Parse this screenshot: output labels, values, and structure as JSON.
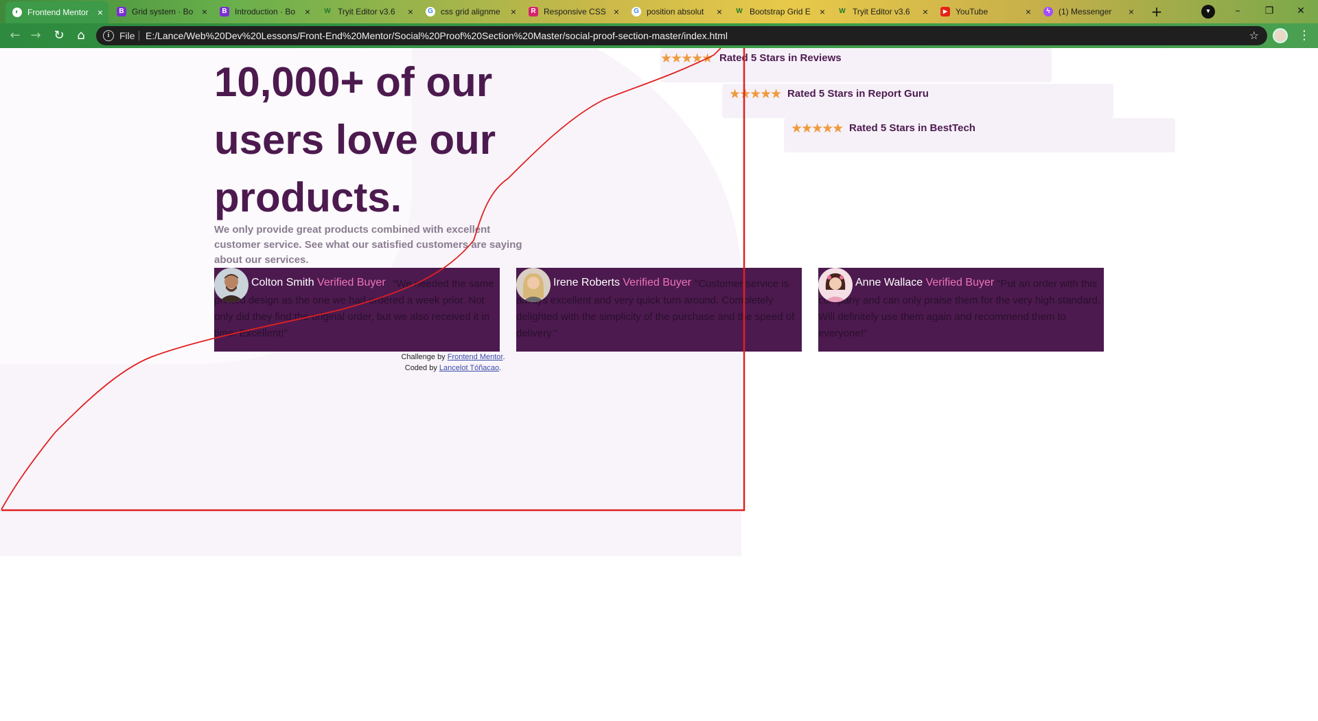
{
  "browser": {
    "tabs": [
      {
        "title": "Frontend Mentor",
        "icon": "frontend-mentor-icon",
        "active": true
      },
      {
        "title": "Grid system · Bo",
        "icon": "bootstrap-icon"
      },
      {
        "title": "Introduction · Bo",
        "icon": "bootstrap-icon"
      },
      {
        "title": "Tryit Editor v3.6",
        "icon": "w3schools-icon"
      },
      {
        "title": "css grid alignme",
        "icon": "google-icon"
      },
      {
        "title": "Responsive CSS",
        "icon": "responsive-css-icon"
      },
      {
        "title": "position absolut",
        "icon": "google-icon"
      },
      {
        "title": "Bootstrap Grid E",
        "icon": "w3schools-icon"
      },
      {
        "title": "Tryit Editor v3.6",
        "icon": "w3schools-icon"
      },
      {
        "title": "YouTube",
        "icon": "youtube-icon"
      },
      {
        "title": "(1) Messenger",
        "icon": "messenger-icon"
      }
    ],
    "close_glyph": "×",
    "new_tab_glyph": "+",
    "address": {
      "scheme_label": "File",
      "url": "E:/Lance/Web%20Dev%20Lessons/Front-End%20Mentor/Social%20Proof%20Section%20Master/social-proof-section-master/index.html"
    },
    "window_controls": {
      "minimize": "–",
      "restore": "❐",
      "close": "✕"
    }
  },
  "page": {
    "hero": {
      "title": "10,000+ of our users love our products.",
      "text": "We only provide great products combined with excellent customer service. See what our satisfied customers are saying about our services."
    },
    "star_glyphs": "★★★★★",
    "ratings": [
      {
        "label": "Rated 5 Stars in Reviews",
        "stars": 5
      },
      {
        "label": "Rated 5 Stars in Report Guru",
        "stars": 5
      },
      {
        "label": "Rated 5 Stars in BestTech",
        "stars": 5
      }
    ],
    "testimonials": [
      {
        "name": "Colton Smith",
        "badge": "Verified Buyer",
        "quote": "\"We needed the same printed design as the one we had ordered a week prior. Not only did they find the original order, but we also received it in time. Excellent!\""
      },
      {
        "name": "Irene Roberts",
        "badge": "Verified Buyer",
        "quote": "\"Customer service is always excellent and very quick turn around. Completely delighted with the simplicity of the purchase and the speed of delivery.\""
      },
      {
        "name": "Anne Wallace",
        "badge": "Verified Buyer",
        "quote": "\"Put an order with this company and can only praise them for the very high standard. Will definitely use them again and recommend them to everyone!\""
      }
    ],
    "attribution": {
      "challenge_prefix": "Challenge by",
      "challenge_link": "Frontend Mentor",
      "coded_prefix": "Coded by",
      "coded_link": "Lancelot Tóñacao"
    }
  },
  "colors": {
    "heading": "#4c1a4f",
    "text": "#8a7c90",
    "card_bg": "#4c1a4f",
    "verified": "#ee74b8",
    "stars": "#ee9b3e",
    "rating_bg": "#f6f1f8",
    "annotation": "#e02020"
  }
}
